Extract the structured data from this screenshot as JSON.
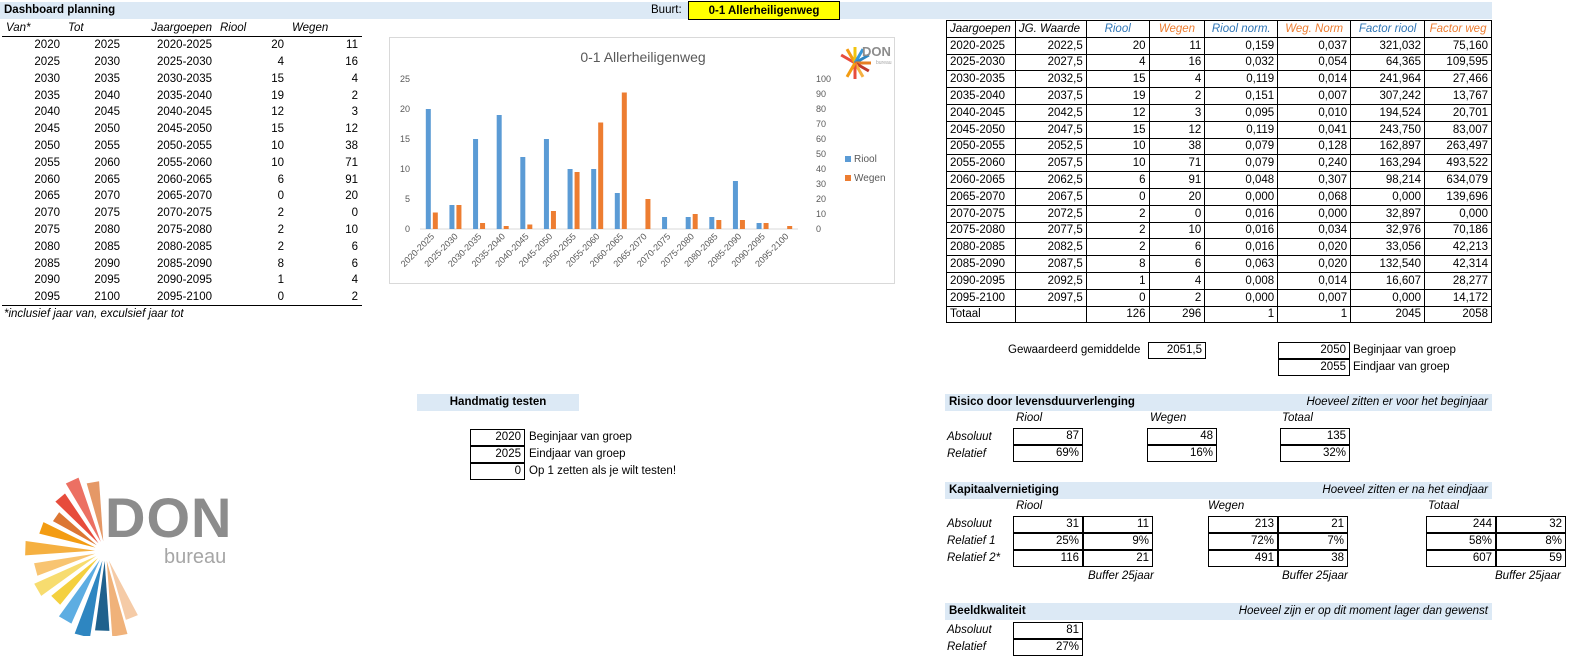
{
  "header": {
    "title": "Dashboard planning",
    "buurt_label": "Buurt:",
    "buurt_value": "0-1 Allerheiligenweg"
  },
  "left_table": {
    "headers": [
      "Van*",
      "Tot",
      "Jaargoepen",
      "Riool",
      "Wegen"
    ],
    "rows": [
      [
        "2020",
        "2025",
        "2020-2025",
        "20",
        "11"
      ],
      [
        "2025",
        "2030",
        "2025-2030",
        "4",
        "16"
      ],
      [
        "2030",
        "2035",
        "2030-2035",
        "15",
        "4"
      ],
      [
        "2035",
        "2040",
        "2035-2040",
        "19",
        "2"
      ],
      [
        "2040",
        "2045",
        "2040-2045",
        "12",
        "3"
      ],
      [
        "2045",
        "2050",
        "2045-2050",
        "15",
        "12"
      ],
      [
        "2050",
        "2055",
        "2050-2055",
        "10",
        "38"
      ],
      [
        "2055",
        "2060",
        "2055-2060",
        "10",
        "71"
      ],
      [
        "2060",
        "2065",
        "2060-2065",
        "6",
        "91"
      ],
      [
        "2065",
        "2070",
        "2065-2070",
        "0",
        "20"
      ],
      [
        "2070",
        "2075",
        "2070-2075",
        "2",
        "0"
      ],
      [
        "2075",
        "2080",
        "2075-2080",
        "2",
        "10"
      ],
      [
        "2080",
        "2085",
        "2080-2085",
        "2",
        "6"
      ],
      [
        "2085",
        "2090",
        "2085-2090",
        "8",
        "6"
      ],
      [
        "2090",
        "2095",
        "2090-2095",
        "1",
        "4"
      ],
      [
        "2095",
        "2100",
        "2095-2100",
        "0",
        "2"
      ]
    ],
    "footnote": "*inclusief jaar van, exculsief jaar tot"
  },
  "chart_data": {
    "type": "bar",
    "title": "0-1 Allerheiligenweg",
    "categories": [
      "2020-2025",
      "2025-2030",
      "2030-2035",
      "2035-2040",
      "2040-2045",
      "2045-2050",
      "2050-2055",
      "2055-2060",
      "2060-2065",
      "2065-2070",
      "2070-2075",
      "2075-2080",
      "2080-2085",
      "2085-2090",
      "2090-2095",
      "2095-2100"
    ],
    "series": [
      {
        "name": "Riool",
        "axis": "left",
        "color": "#5b9bd5",
        "values": [
          20,
          4,
          15,
          19,
          12,
          15,
          10,
          10,
          6,
          0,
          2,
          2,
          2,
          8,
          1,
          0
        ]
      },
      {
        "name": "Wegen",
        "axis": "right",
        "color": "#ed7d31",
        "values": [
          11,
          16,
          4,
          2,
          3,
          12,
          38,
          71,
          91,
          20,
          0,
          10,
          6,
          6,
          4,
          2
        ]
      }
    ],
    "ylim_left": [
      0,
      25
    ],
    "ylim_right": [
      0,
      100
    ],
    "left_ticks": [
      "0",
      "5",
      "10",
      "15",
      "20",
      "25"
    ],
    "right_ticks": [
      "0",
      "10",
      "20",
      "30",
      "40",
      "50",
      "60",
      "70",
      "80",
      "90",
      "100"
    ],
    "legend_position": "right",
    "grid": false
  },
  "chart_logo": {
    "text": "DON",
    "sub": "bureau"
  },
  "right_table": {
    "headers": [
      "Jaargoepen",
      "JG. Waarde",
      "Riool",
      "Wegen",
      "Riool norm.",
      "Weg. Norm",
      "Factor riool",
      "Factor weg"
    ],
    "header_colors": [
      "#000000",
      "#000000",
      "#2e75b6",
      "#ed7d31",
      "#2e75b6",
      "#ed7d31",
      "#2e75b6",
      "#ed7d31"
    ],
    "rows": [
      [
        "2020-2025",
        "2022,5",
        "20",
        "11",
        "0,159",
        "0,037",
        "321,032",
        "75,160"
      ],
      [
        "2025-2030",
        "2027,5",
        "4",
        "16",
        "0,032",
        "0,054",
        "64,365",
        "109,595"
      ],
      [
        "2030-2035",
        "2032,5",
        "15",
        "4",
        "0,119",
        "0,014",
        "241,964",
        "27,466"
      ],
      [
        "2035-2040",
        "2037,5",
        "19",
        "2",
        "0,151",
        "0,007",
        "307,242",
        "13,767"
      ],
      [
        "2040-2045",
        "2042,5",
        "12",
        "3",
        "0,095",
        "0,010",
        "194,524",
        "20,701"
      ],
      [
        "2045-2050",
        "2047,5",
        "15",
        "12",
        "0,119",
        "0,041",
        "243,750",
        "83,007"
      ],
      [
        "2050-2055",
        "2052,5",
        "10",
        "38",
        "0,079",
        "0,128",
        "162,897",
        "263,497"
      ],
      [
        "2055-2060",
        "2057,5",
        "10",
        "71",
        "0,079",
        "0,240",
        "163,294",
        "493,522"
      ],
      [
        "2060-2065",
        "2062,5",
        "6",
        "91",
        "0,048",
        "0,307",
        "98,214",
        "634,079"
      ],
      [
        "2065-2070",
        "2067,5",
        "0",
        "20",
        "0,000",
        "0,068",
        "0,000",
        "139,696"
      ],
      [
        "2070-2075",
        "2072,5",
        "2",
        "0",
        "0,016",
        "0,000",
        "32,897",
        "0,000"
      ],
      [
        "2075-2080",
        "2077,5",
        "2",
        "10",
        "0,016",
        "0,034",
        "32,976",
        "70,186"
      ],
      [
        "2080-2085",
        "2082,5",
        "2",
        "6",
        "0,016",
        "0,020",
        "33,056",
        "42,213"
      ],
      [
        "2085-2090",
        "2087,5",
        "8",
        "6",
        "0,063",
        "0,020",
        "132,540",
        "42,314"
      ],
      [
        "2090-2095",
        "2092,5",
        "1",
        "4",
        "0,008",
        "0,014",
        "16,607",
        "28,277"
      ],
      [
        "2095-2100",
        "2097,5",
        "0",
        "2",
        "0,000",
        "0,007",
        "0,000",
        "14,172"
      ]
    ],
    "total_row": [
      "Totaal",
      "",
      "126",
      "296",
      "1",
      "1",
      "2045",
      "2058"
    ]
  },
  "gewogen": {
    "label": "Gewaardeerd gemiddelde",
    "value": "2051,5"
  },
  "group_years": {
    "begin_value": "2050",
    "begin_label": "Beginjaar van groep",
    "end_value": "2055",
    "end_label": "Eindjaar van groep"
  },
  "handmatig": {
    "title": "Handmatig testen",
    "begin_value": "2020",
    "begin_label": "Beginjaar van groep",
    "end_value": "2025",
    "end_label": "Eindjaar van groep",
    "test_value": "0",
    "test_label": "Op 1 zetten als je wilt testen!"
  },
  "risico": {
    "title": "Risico door levensduurverlenging",
    "note": "Hoeveel zitten er voor het beginjaar",
    "col_riool": "Riool",
    "col_wegen": "Wegen",
    "col_totaal": "Totaal",
    "row_abs": "Absoluut",
    "row_rel": "Relatief",
    "abs": [
      "87",
      "48",
      "135"
    ],
    "rel": [
      "69%",
      "16%",
      "32%"
    ]
  },
  "kapitaal": {
    "title": "Kapitaalvernietiging",
    "note": "Hoeveel zitten er na het eindjaar",
    "col_riool": "Riool",
    "col_wegen": "Wegen",
    "col_totaal": "Totaal",
    "row_labels": [
      "Absoluut",
      "Relatief 1",
      "Relatief 2*"
    ],
    "riool": [
      [
        "31",
        "11"
      ],
      [
        "25%",
        "9%"
      ],
      [
        "116",
        "21"
      ]
    ],
    "wegen": [
      [
        "213",
        "21"
      ],
      [
        "72%",
        "7%"
      ],
      [
        "491",
        "38"
      ]
    ],
    "totaal": [
      [
        "244",
        "32"
      ],
      [
        "58%",
        "8%"
      ],
      [
        "607",
        "59"
      ]
    ],
    "buffer": "Buffer 25jaar"
  },
  "beeld": {
    "title": "Beeldkwaliteit",
    "note": "Hoeveel zijn er op dit moment lager dan gewenst",
    "row_abs": "Absoluut",
    "row_rel": "Relatief",
    "abs": "81",
    "rel": "27%"
  },
  "logo": {
    "text": "DON",
    "sub": "bureau"
  }
}
